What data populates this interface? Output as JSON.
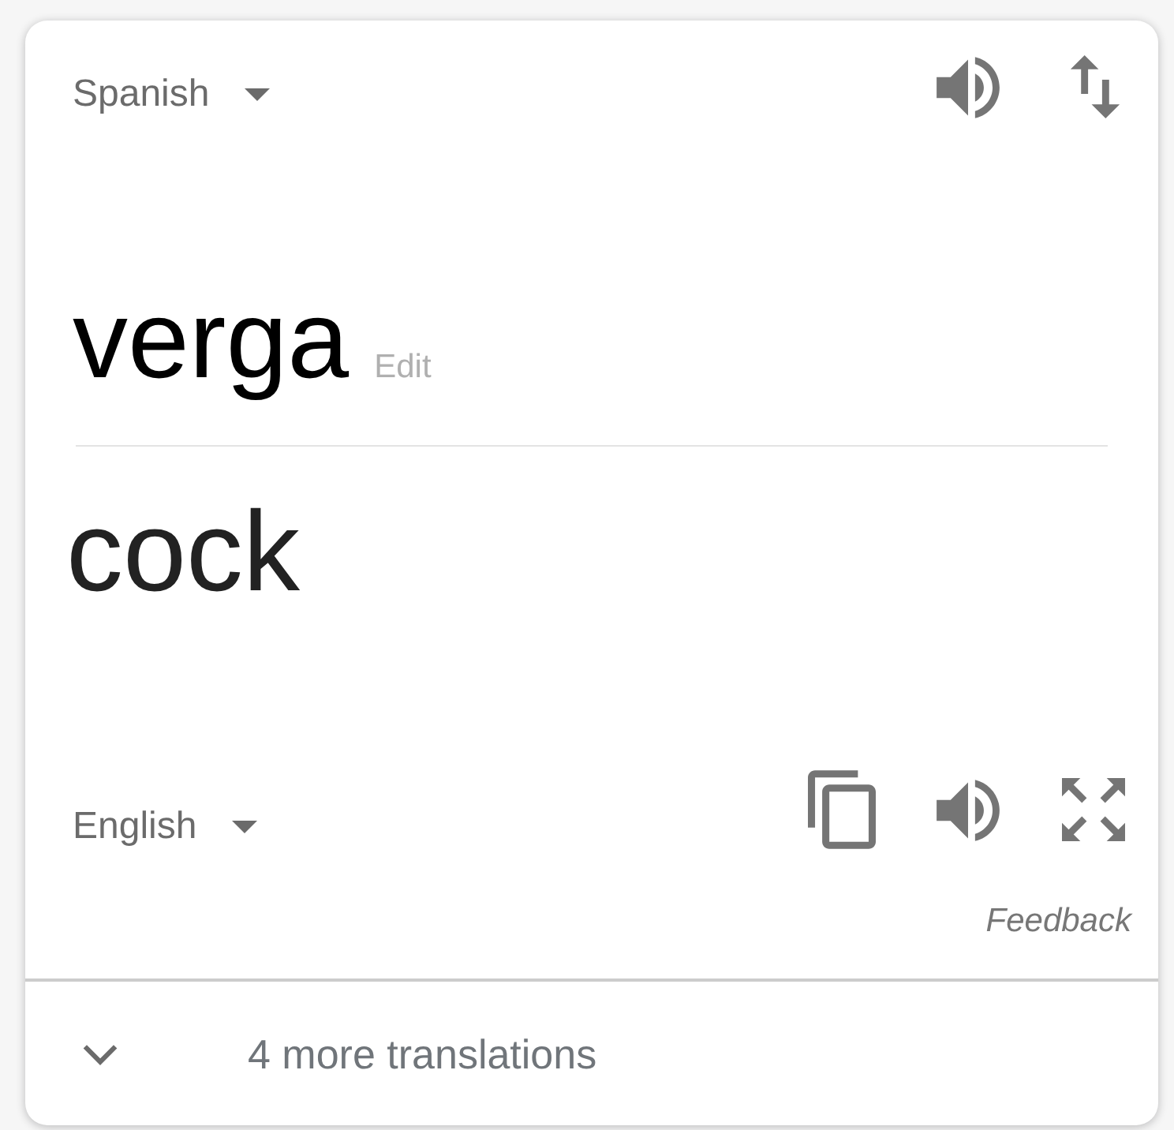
{
  "source": {
    "language": "Spanish",
    "text": "verga",
    "edit_label": "Edit"
  },
  "target": {
    "language": "English",
    "text": "cock"
  },
  "feedback": "Feedback",
  "more_translations": {
    "label": "4 more translations",
    "expanded": false
  }
}
